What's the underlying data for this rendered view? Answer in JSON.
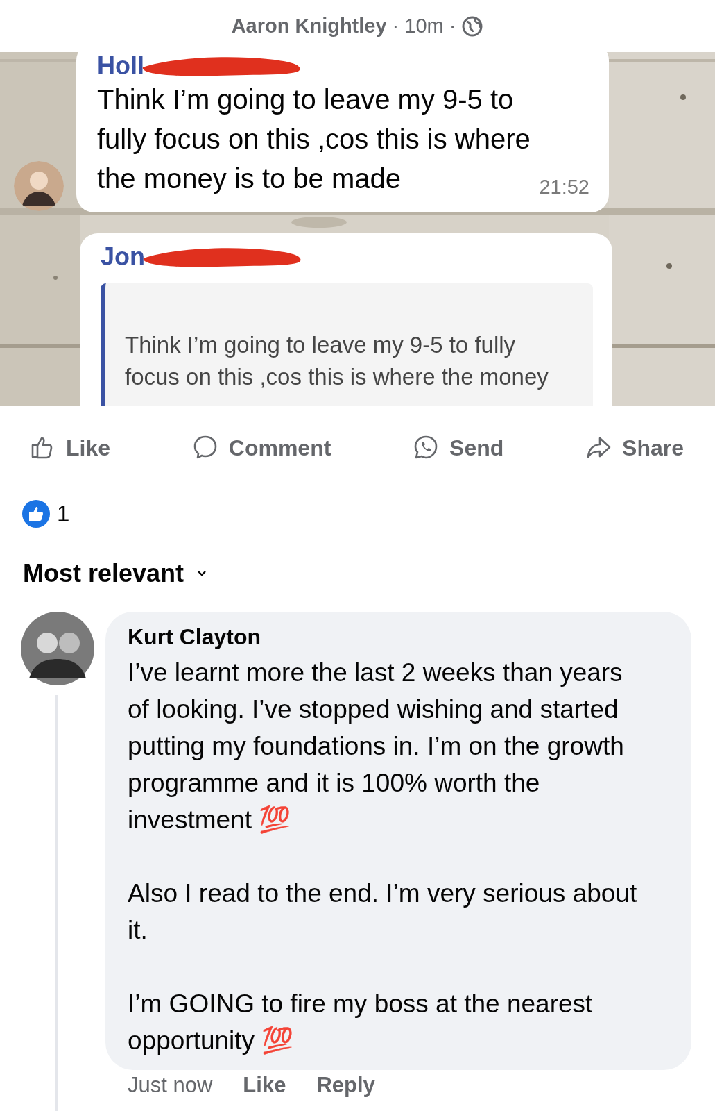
{
  "post": {
    "author": "Aaron Knightley",
    "separator": "·",
    "time": "10m"
  },
  "image": {
    "messages": [
      {
        "sender": "Holl",
        "text": "Think I’m going to leave my 9-5 to fully focus on this ,cos this is where the money is to be made",
        "time": "21:52",
        "redacted": true
      },
      {
        "sender": "Jon",
        "quote": "Think I’m going to leave my 9-5 to fully focus on this ,cos this is where the money",
        "redacted": true
      }
    ]
  },
  "actions": [
    {
      "kind": "like",
      "label": "Like"
    },
    {
      "kind": "comment",
      "label": "Comment"
    },
    {
      "kind": "send",
      "label": "Send"
    },
    {
      "kind": "share",
      "label": "Share"
    }
  ],
  "reactions": {
    "count": "1"
  },
  "sort": {
    "label": "Most relevant"
  },
  "comments": [
    {
      "author": "Kurt Clayton",
      "paragraphs": [
        "I’ve learnt more the last 2 weeks than years of looking. I’ve stopped wishing and started putting my foundations in. I’m on the growth programme and it is 100% worth the investment 💯",
        "Also I read to the end. I’m very serious about it.",
        "I’m GOING to fire my boss at the nearest opportunity 💯"
      ],
      "time": "Just now",
      "links": [
        "Like",
        "Reply"
      ]
    }
  ]
}
